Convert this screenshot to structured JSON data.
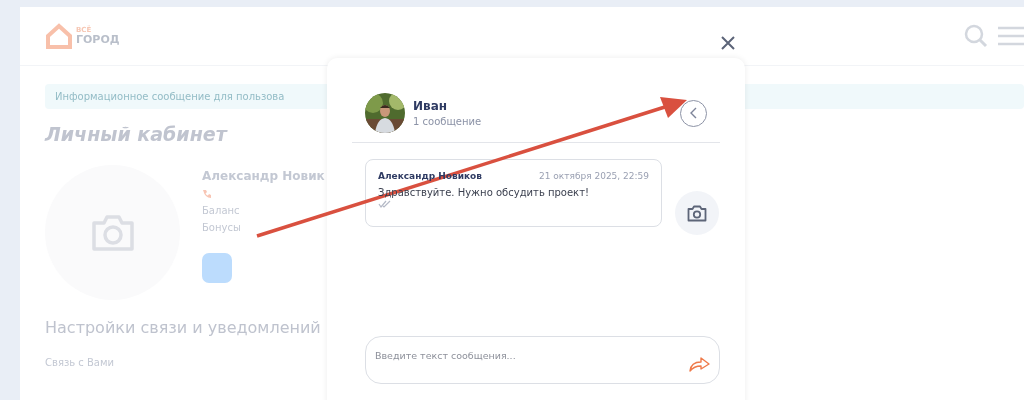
{
  "page": {
    "logo": {
      "line_1": "ВСЁ",
      "line_2": "ГОРОД"
    },
    "banner": "Информационное сообщение для пользова",
    "heading": "Личный кабинет",
    "profile": {
      "name": "Александр Новик",
      "lines": [
        "Баланс",
        "Бонусы"
      ]
    },
    "settings_heading": "Настройки связи и уведомлений",
    "settings_label": "Связь с Вами"
  },
  "chat": {
    "contact": {
      "name": "Иван",
      "count": "1 сообщение"
    },
    "messages": [
      {
        "author": "Александр Новиков",
        "time": "21 октября 2025, 22:59",
        "text": "Здравствуйте. Нужно обсудить проект!",
        "read": true
      }
    ],
    "input": {
      "placeholder": "Введите текст сообщения..."
    }
  },
  "annotation": {
    "kind": "arrow",
    "color": "#d9503f"
  }
}
